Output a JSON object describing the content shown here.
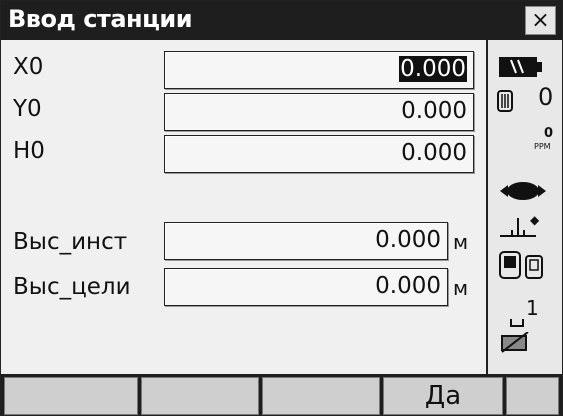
{
  "window": {
    "title": "Ввод станции",
    "close_label": "×"
  },
  "fields": [
    {
      "label": "X0",
      "value": "0.000"
    },
    {
      "label": "Y0",
      "value": "0.000"
    },
    {
      "label": "H0",
      "value": "0.000"
    },
    {
      "label": "Выс_инст",
      "value": "0.000",
      "unit": "м"
    },
    {
      "label": "Выс_цели",
      "value": "0.000",
      "unit": "м"
    }
  ],
  "status": {
    "prism_constant": "0",
    "ppm_value": "0",
    "ppm_unit": "PPM",
    "page_number": "1"
  },
  "softkeys": [
    "",
    "",
    "",
    "Да",
    ""
  ]
}
